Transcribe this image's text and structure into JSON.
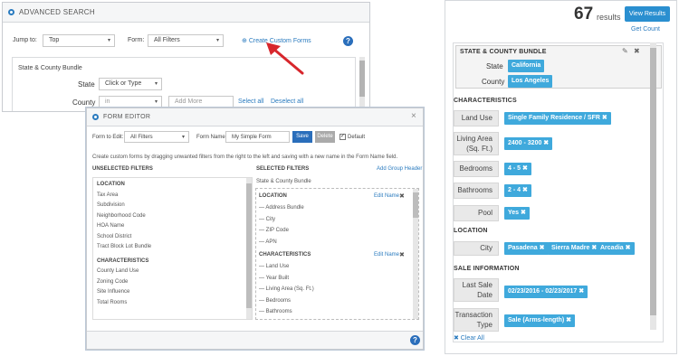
{
  "adv": {
    "title": "ADVANCED SEARCH",
    "jump_label": "Jump to:",
    "jump_value": "Top",
    "form_label": "Form:",
    "form_value": "All Filters",
    "create_link": "Create Custom Forms",
    "section": "State & County Bundle",
    "state_label": "State",
    "state_ph": "Click or Type",
    "county_label": "County",
    "county_val": "in",
    "add_more": "Add More",
    "select_all": "Select all",
    "deselect_all": "Deselect all"
  },
  "fe": {
    "title": "FORM EDITOR",
    "form_to_edit_label": "Form to Edit:",
    "form_to_edit_value": "All Filters",
    "form_name_label": "Form Name:",
    "form_name_value": "My Simple Form",
    "save": "Save",
    "delete": "Delete",
    "default_label": "Default",
    "instructions": "Create custom forms by dragging unwanted filters from the right to the left and saving with a new name in the Form Name field.",
    "unsel_title": "UNSELECTED FILTERS",
    "sel_title": "SELECTED FILTERS",
    "add_group": "Add Group Header",
    "unsel": [
      {
        "h": "LOCATION"
      },
      {
        "t": "Tax Area"
      },
      {
        "t": "Subdivision"
      },
      {
        "t": "Neighborhood Code"
      },
      {
        "t": "HOA Name"
      },
      {
        "t": "School District"
      },
      {
        "t": "Tract Block Lot Bundle"
      },
      {
        "h": "CHARACTERISTICS"
      },
      {
        "t": "County Land Use"
      },
      {
        "t": "Zoning Code"
      },
      {
        "t": "Site Influence"
      },
      {
        "t": "Total Rooms"
      }
    ],
    "sel_top": "State & County Bundle",
    "g1": {
      "h": "LOCATION",
      "edit": "Edit Name",
      "items": [
        "Address Bundle",
        "City",
        "ZIP Code",
        "APN"
      ]
    },
    "g2": {
      "h": "CHARACTERISTICS",
      "edit": "Edit Name",
      "items": [
        "Land Use",
        "Year Built",
        "Living Area (Sq. Ft.)",
        "Bedrooms",
        "Bathrooms"
      ]
    }
  },
  "rp": {
    "count": "67",
    "results": "results",
    "view_results": "View Results",
    "get_count": "Get Count",
    "bundle_title": "STATE & COUNTY BUNDLE",
    "state_label": "State",
    "state_tag": "California",
    "county_label": "County",
    "county_tag": "Los Angeles",
    "char_title": "CHARACTERISTICS",
    "chars": [
      {
        "label": "Land Use",
        "tag": "Single Family Residence / SFR ✖"
      },
      {
        "label": "Living Area (Sq. Ft.)",
        "tag": "2400 - 3200 ✖"
      },
      {
        "label": "Bedrooms",
        "tag": "4 - 5 ✖"
      },
      {
        "label": "Bathrooms",
        "tag": "2 - 4 ✖"
      },
      {
        "label": "Pool",
        "tag": "Yes ✖"
      }
    ],
    "loc_title": "LOCATION",
    "city_label": "City",
    "cities": [
      "Pasadena ✖",
      "Sierra Madre ✖",
      "Arcadia ✖"
    ],
    "sale_title": "SALE INFORMATION",
    "last_sale_label": "Last Sale Date",
    "last_sale_tag": "02/23/2016 - 02/23/2017 ✖",
    "trans_label": "Transaction Type",
    "trans_tag": "Sale (Arms-length) ✖",
    "clear_all": "✖ Clear All"
  },
  "colors": {
    "accent": "#2a7bbf",
    "tag": "#3fa9dc",
    "arrow": "#d7262c"
  }
}
